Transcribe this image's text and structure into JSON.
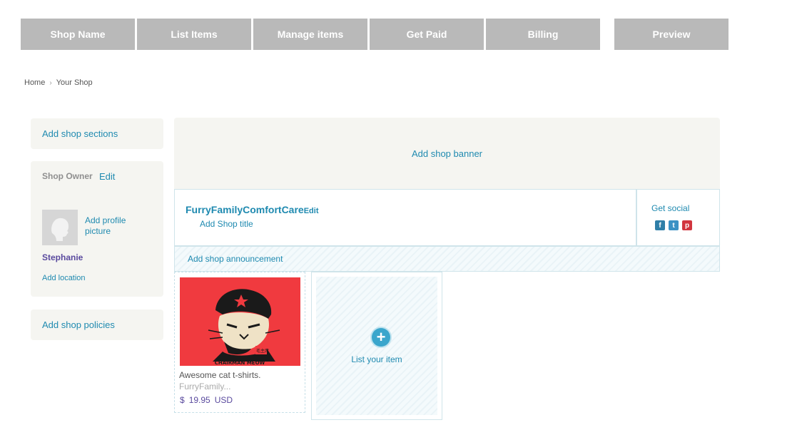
{
  "tabs": [
    {
      "label": "Shop Name"
    },
    {
      "label": "List Items"
    },
    {
      "label": "Manage items"
    },
    {
      "label": "Get Paid"
    },
    {
      "label": "Billing"
    },
    {
      "label": "Preview"
    }
  ],
  "breadcrumb": {
    "home": "Home",
    "separator": "›",
    "current": "Your Shop"
  },
  "sidebar": {
    "add_sections": "Add shop sections",
    "owner_label": "Shop Owner",
    "owner_edit": "Edit",
    "add_profile_picture": "Add profile picture",
    "owner_name": "Stephanie",
    "add_location": "Add location",
    "add_policies": "Add shop policies"
  },
  "banner": {
    "label": "Add shop banner"
  },
  "shop": {
    "name": "FurryFamilyComfortCare",
    "edit": "Edit",
    "add_title": "Add Shop title",
    "get_social": "Get social",
    "add_announcement": "Add shop announcement"
  },
  "social_icons": [
    "facebook-icon",
    "twitter-icon",
    "pinterest-icon"
  ],
  "item": {
    "title": "Awesome cat t-shirts.",
    "shop": "FurryFamily...",
    "currency_symbol": "$",
    "price": "19.95",
    "currency": "USD",
    "image_caption": "CHAIRMAN MEOW",
    "image_stamp": "毛主席"
  },
  "list_item": {
    "label": "List your item",
    "plus": "+"
  },
  "colors": {
    "link": "#1f8ab0",
    "tab_bg": "#b9b9b9",
    "panel_bg": "#f5f5f1",
    "price": "#5a4a9e",
    "item_bg": "#f03a3f"
  }
}
